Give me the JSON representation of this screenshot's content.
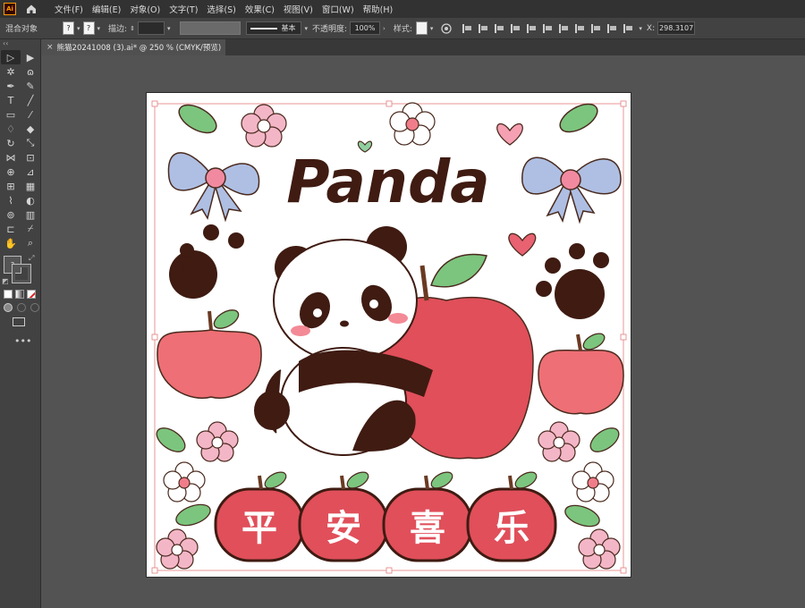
{
  "app": {
    "logo_text": "Ai"
  },
  "menu": [
    "文件(F)",
    "编辑(E)",
    "对象(O)",
    "文字(T)",
    "选择(S)",
    "效果(C)",
    "视图(V)",
    "窗口(W)",
    "帮助(H)"
  ],
  "control": {
    "mixed_objects": "混合对象",
    "fill_swatch": "?",
    "stroke_swatch": "?",
    "stroke_label": "描边:",
    "brush_label": "基本",
    "opacity_label": "不透明度:",
    "opacity_value": "100%",
    "style_label": "样式:",
    "x_label": "X:",
    "x_value": "298.3107"
  },
  "document": {
    "tab_title": "熊猫20241008 (3).ai* @ 250 % (CMYK/预览)"
  },
  "artwork": {
    "title": "Panda",
    "slogan_chars": [
      "平",
      "安",
      "喜",
      "乐"
    ]
  },
  "colors": {
    "apple_red": "#e04f5a",
    "light_red": "#ee6f75",
    "panda_dark": "#3f1b12",
    "leaf_green": "#7cc57e",
    "pink_flower": "#f3b6c7",
    "bow_blue": "#aebfe3",
    "heart_pink": "#f6a0b3"
  }
}
